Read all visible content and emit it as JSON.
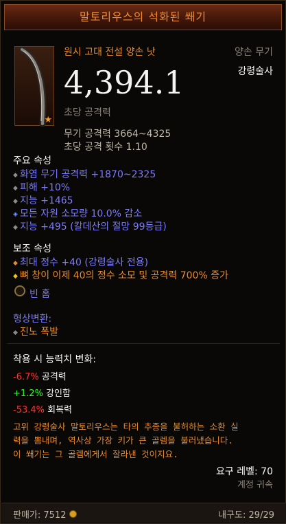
{
  "item": {
    "name": "말토리우스의 석화된 쐐기",
    "quality": "원시 고대 전설 양손 낫",
    "type": "양손 무기",
    "class": "강령술사",
    "dps": "4,394.1",
    "dps_label": "초당 공격력",
    "weapon_damage": "무기 공격력 3664~4325",
    "attack_speed": "초당 공격 횟수 1.10"
  },
  "primary": {
    "header": "주요 속성",
    "stats": [
      "화염 무기 공격력 +1870~2325",
      "피해 +10%",
      "지능 +1465",
      "모든 자원 소모량 10.0% 감소",
      "지능 +495 (칼데산의 절망 99등급)"
    ]
  },
  "secondary": {
    "header": "보조 속성",
    "stats": [
      "최대 정수 +40 (강령술사 전용)",
      "뼈 창이 이제 40의 정수 소모 및 공격력 700% 증가"
    ]
  },
  "socket": {
    "label": "빈 홈"
  },
  "transmog": {
    "header": "형상변환:",
    "value": "진노 폭발"
  },
  "equip_changes": {
    "header": "착용 시 능력치 변화:",
    "rows": [
      {
        "value": "-6.7%",
        "label": "공격력"
      },
      {
        "value": "+1.2%",
        "label": "강인함"
      },
      {
        "value": "-53.4%",
        "label": "회복력"
      }
    ]
  },
  "flavor": {
    "lines": [
      "고위 강령술사 말토리우스는 타의 추종을 불허하는 소환 실",
      "력을 뽐내며, 역사상 가장 키가 큰 골렘을 불러냈습니다.",
      "이 쐐기는 그 골렘에게서 잘라낸 것이지요."
    ]
  },
  "required_level": "요구 레벨: 70",
  "account_bound": "계정 귀속",
  "sell_value": "판매가: 7512",
  "durability": "내구도: 29/29",
  "colors": {
    "legendary": "#e88a2a",
    "affix_blue": "#7b7bff",
    "negative": "#ff3434",
    "positive": "#2aff2a"
  }
}
